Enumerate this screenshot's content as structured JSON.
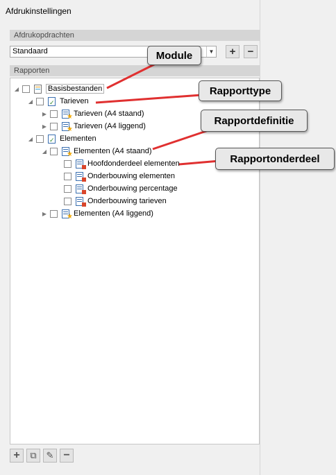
{
  "window": {
    "title": "Afdrukinstellingen"
  },
  "print_jobs": {
    "header": "Afdrukopdrachten",
    "selected": "Standaard",
    "add_label": "+",
    "remove_label": "−"
  },
  "reports": {
    "header": "Rapporten",
    "tree": {
      "module": "Basisbestanden",
      "type1": "Tarieven",
      "type1_defs": [
        "Tarieven (A4 staand)",
        "Tarieven (A4 liggend)"
      ],
      "type2": "Elementen",
      "type2_def1": "Elementen (A4 staand)",
      "parts": [
        "Hoofdonderdeel elementen",
        "Onderbouwing elementen",
        "Onderbouwing percentage",
        "Onderbouwing tarieven"
      ],
      "type2_def2": "Elementen (A4 liggend)"
    }
  },
  "callouts": {
    "module": "Module",
    "report_type": "Rapporttype",
    "report_definition": "Rapportdefinitie",
    "report_part": "Rapportonderdeel"
  },
  "colors": {
    "arrow": "#e03030",
    "callout_bg": "#e8e8e8"
  }
}
